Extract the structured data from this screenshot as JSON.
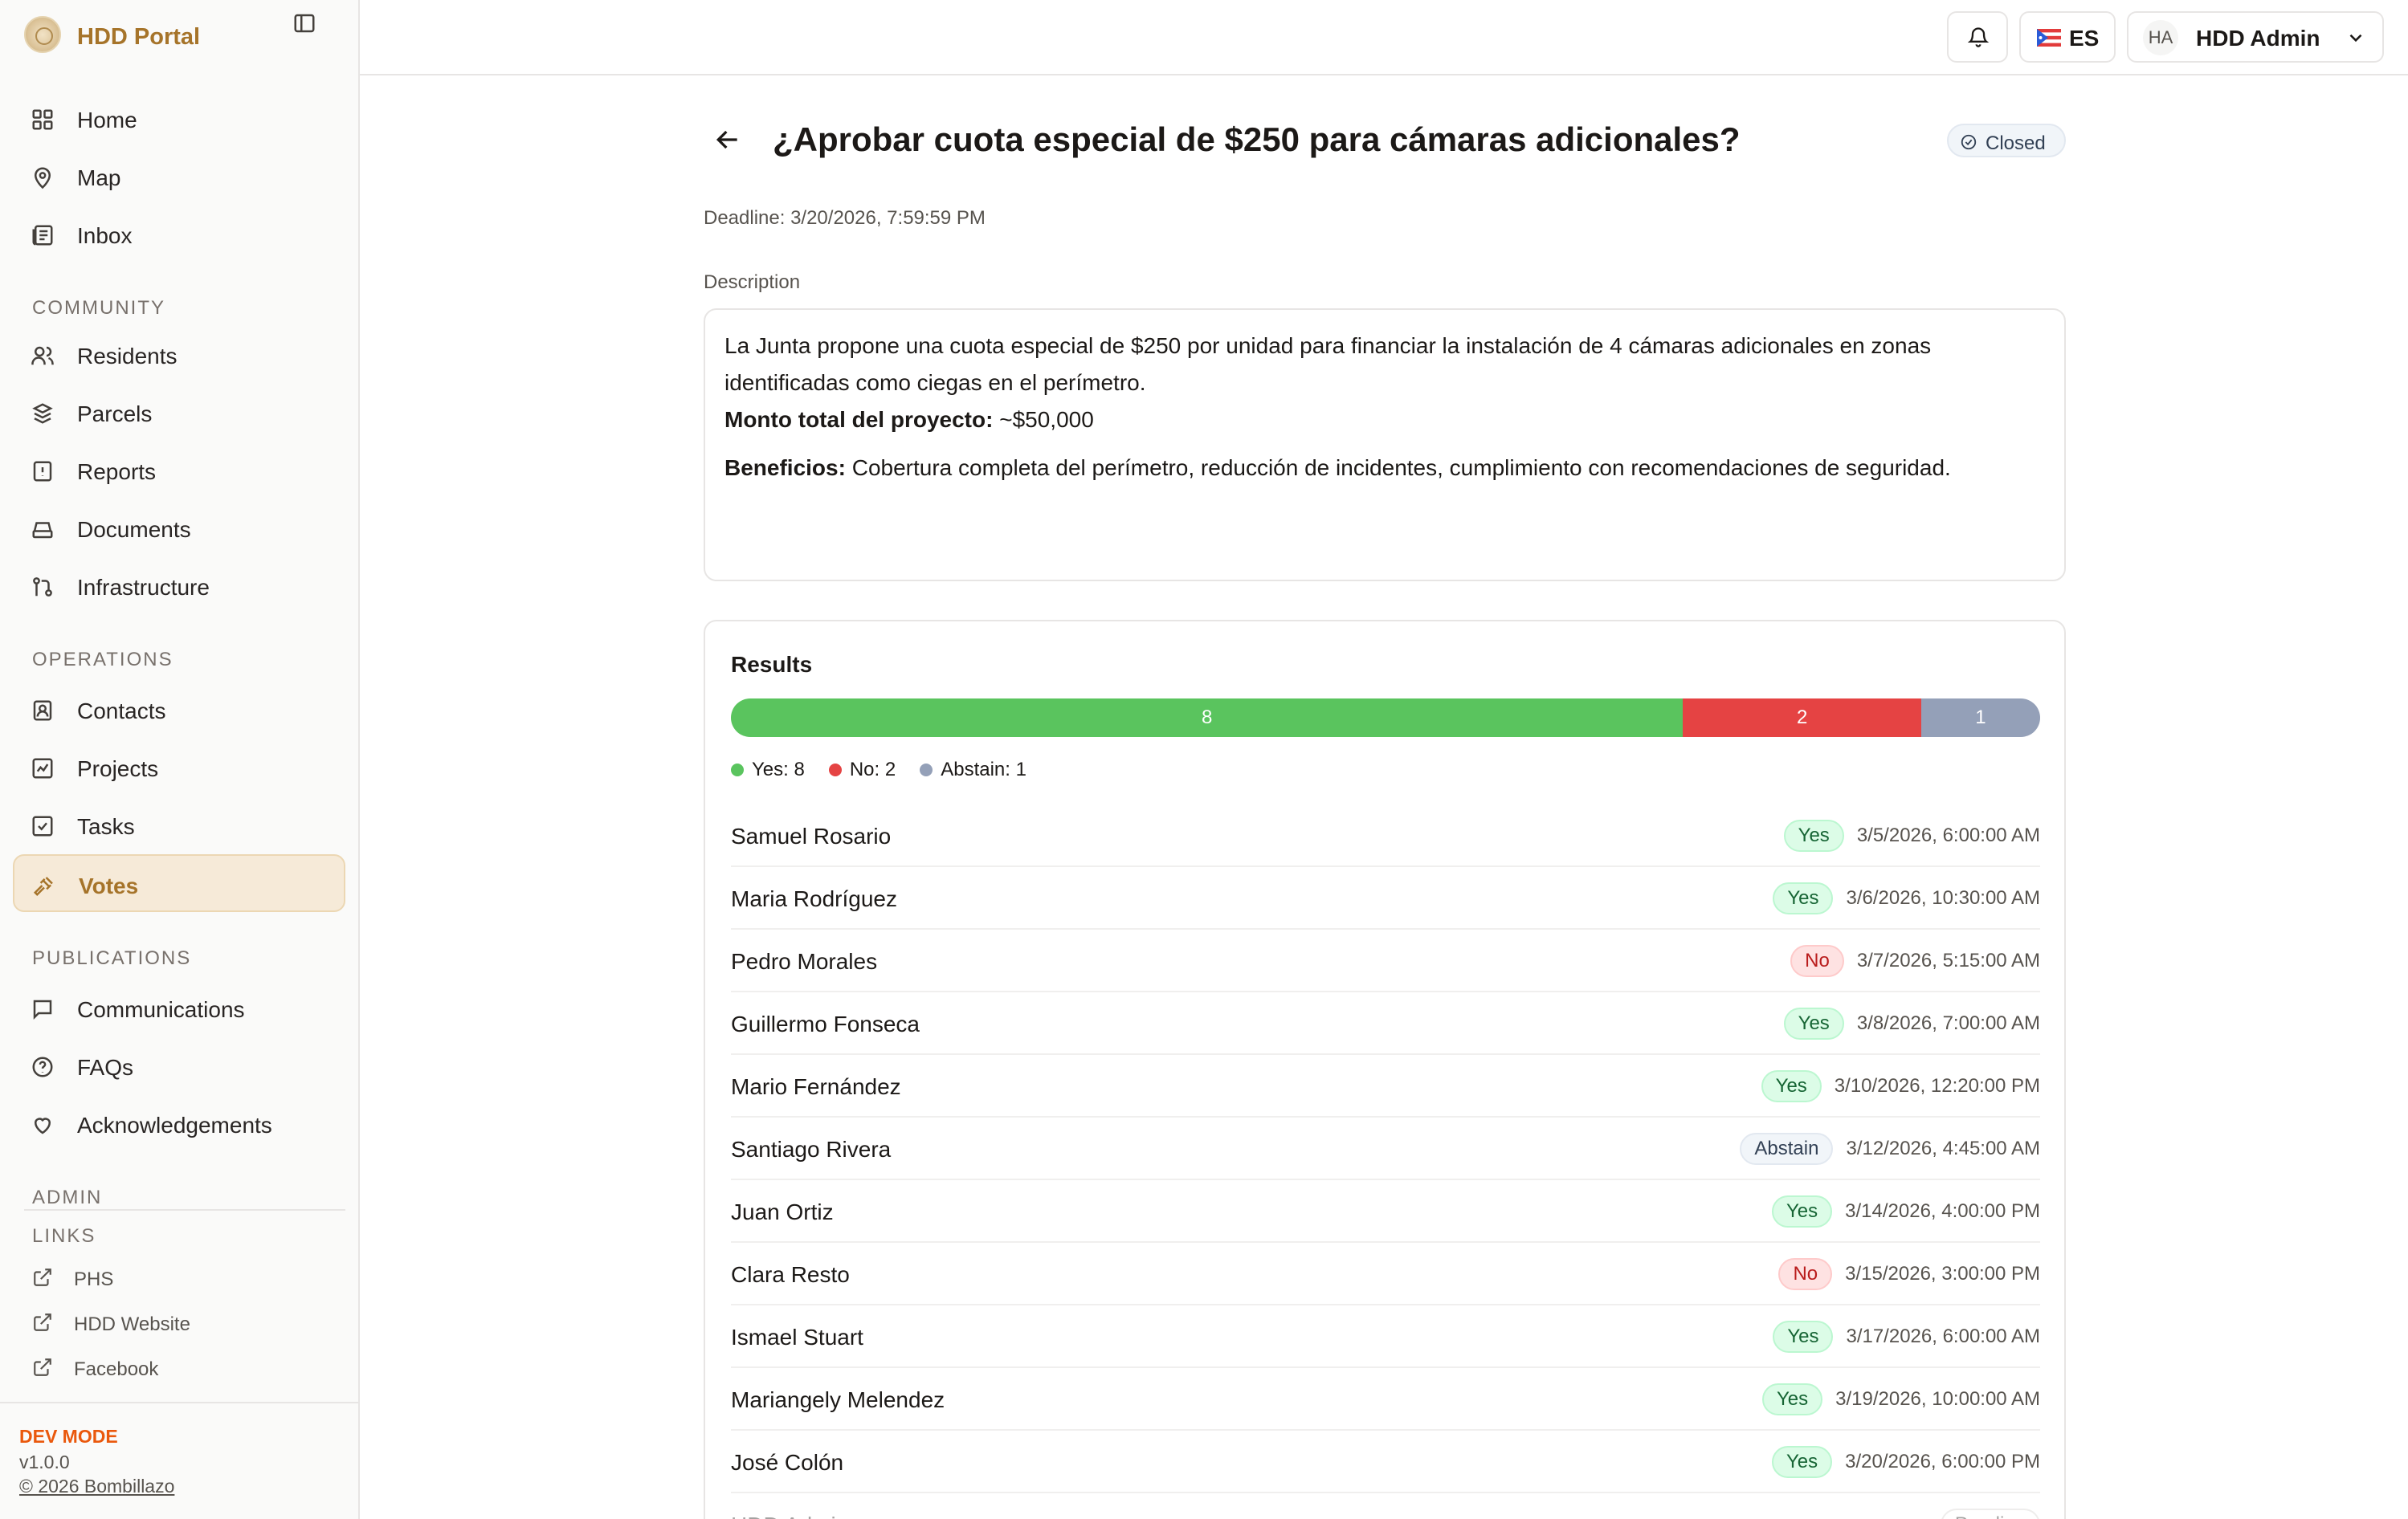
{
  "brand": {
    "name": "HDD Portal"
  },
  "nav": {
    "home": "Home",
    "map": "Map",
    "inbox": "Inbox",
    "community_label": "COMMUNITY",
    "residents": "Residents",
    "parcels": "Parcels",
    "reports": "Reports",
    "documents": "Documents",
    "infrastructure": "Infrastructure",
    "operations_label": "OPERATIONS",
    "contacts": "Contacts",
    "projects": "Projects",
    "tasks": "Tasks",
    "votes": "Votes",
    "publications_label": "PUBLICATIONS",
    "communications": "Communications",
    "faqs": "FAQs",
    "acknowledgements": "Acknowledgements",
    "admin_label": "ADMIN",
    "links_label": "LINKS",
    "links": [
      "PHS",
      "HDD Website",
      "Facebook"
    ]
  },
  "footer": {
    "dev_mode": "DEV MODE",
    "version": "v1.0.0",
    "copyright": "© 2026 Bombillazo"
  },
  "topbar": {
    "language": "ES",
    "user_initials": "HA",
    "user_name": "HDD Admin"
  },
  "vote": {
    "title": "¿Aprobar cuota especial de $250 para cámaras adicionales?",
    "status": "Closed",
    "deadline": "Deadline: 3/20/2026, 7:59:59 PM",
    "description_label": "Description",
    "description_p1": "La Junta propone una cuota especial de $250 por unidad para financiar la instalación de 4 cámaras adicionales en zonas identificadas como ciegas en el perímetro.",
    "description_p2_label": "Monto total del proyecto:",
    "description_p2_text": " ~$50,000",
    "description_p3_label": "Beneficios:",
    "description_p3_text": " Cobertura completa del perímetro, reducción de incidentes, cumplimiento con recomendaciones de seguridad."
  },
  "results": {
    "title": "Results",
    "yes_count": "8",
    "no_count": "2",
    "abstain_count": "1",
    "legend_yes": "Yes: 8",
    "legend_no": "No: 2",
    "legend_abstain": "Abstain: 1",
    "colors": {
      "yes": "#5ac45e",
      "no": "#e54343",
      "abstain": "#94a0b8"
    },
    "votes": [
      {
        "name": "Samuel Rosario",
        "choice": "Yes",
        "date": "3/5/2026, 6:00:00 AM"
      },
      {
        "name": "Maria Rodríguez",
        "choice": "Yes",
        "date": "3/6/2026, 10:30:00 AM"
      },
      {
        "name": "Pedro Morales",
        "choice": "No",
        "date": "3/7/2026, 5:15:00 AM"
      },
      {
        "name": "Guillermo Fonseca",
        "choice": "Yes",
        "date": "3/8/2026, 7:00:00 AM"
      },
      {
        "name": "Mario Fernández",
        "choice": "Yes",
        "date": "3/10/2026, 12:20:00 PM"
      },
      {
        "name": "Santiago Rivera",
        "choice": "Abstain",
        "date": "3/12/2026, 4:45:00 AM"
      },
      {
        "name": "Juan Ortiz",
        "choice": "Yes",
        "date": "3/14/2026, 4:00:00 PM"
      },
      {
        "name": "Clara Resto",
        "choice": "No",
        "date": "3/15/2026, 3:00:00 PM"
      },
      {
        "name": "Ismael Stuart",
        "choice": "Yes",
        "date": "3/17/2026, 6:00:00 AM"
      },
      {
        "name": "Mariangely Melendez",
        "choice": "Yes",
        "date": "3/19/2026, 10:00:00 AM"
      },
      {
        "name": "José Colón",
        "choice": "Yes",
        "date": "3/20/2026, 6:00:00 PM"
      },
      {
        "name": "HDD Admin",
        "choice": "Pending",
        "date": ""
      }
    ]
  }
}
